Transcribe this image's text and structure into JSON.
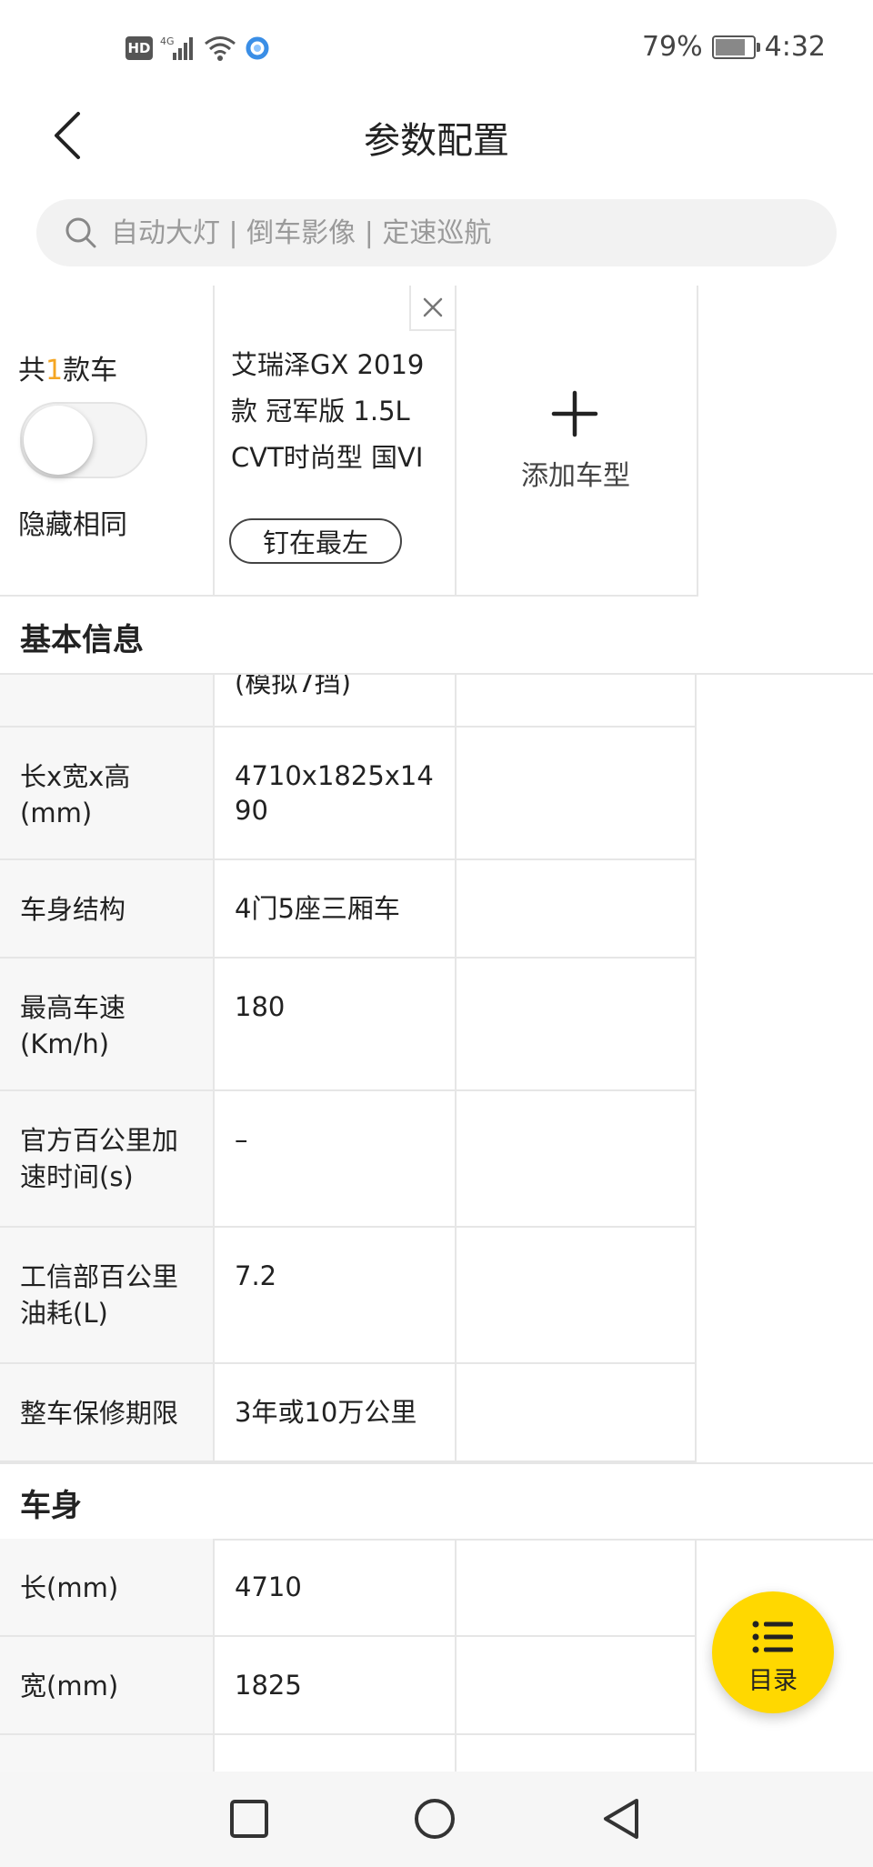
{
  "status_bar": {
    "hd": "HD",
    "network": "4G",
    "battery_percent": "79%",
    "battery_level": 0.79,
    "time": "4:32"
  },
  "header": {
    "title": "参数配置"
  },
  "search": {
    "placeholder": "自动大灯 | 倒车影像 | 定速巡航"
  },
  "compare": {
    "count_prefix": "共",
    "count": "1",
    "count_suffix": "款车",
    "hide_same_label": "隐藏相同",
    "hide_same_on": false,
    "car_name": "艾瑞泽GX 2019款 冠军版 1.5L CVT时尚型 国VI",
    "pin_label": "钉在最左",
    "add_label": "添加车型"
  },
  "sections": {
    "basic_title": "基本信息",
    "body_title": "车身"
  },
  "partial_row_value": "(模拟7挡)",
  "basic_rows": [
    {
      "label": "长x宽x高(mm)",
      "value": "4710x1825x1490"
    },
    {
      "label": "车身结构",
      "value": "4门5座三厢车"
    },
    {
      "label": "最高车速(Km/h)",
      "value": "180"
    },
    {
      "label": "官方百公里加速时间(s)",
      "value": "–"
    },
    {
      "label": "工信部百公里油耗(L)",
      "value": "7.2"
    },
    {
      "label": "整车保修期限",
      "value": "3年或10万公里"
    }
  ],
  "body_rows": [
    {
      "label": "长(mm)",
      "value": "4710"
    },
    {
      "label": "宽(mm)",
      "value": "1825"
    }
  ],
  "fab": {
    "label": "目录"
  },
  "colors": {
    "accent": "#f5a623",
    "fab": "#ffd800",
    "border": "#e6e6e6",
    "label_bg": "#f7f7f7"
  }
}
